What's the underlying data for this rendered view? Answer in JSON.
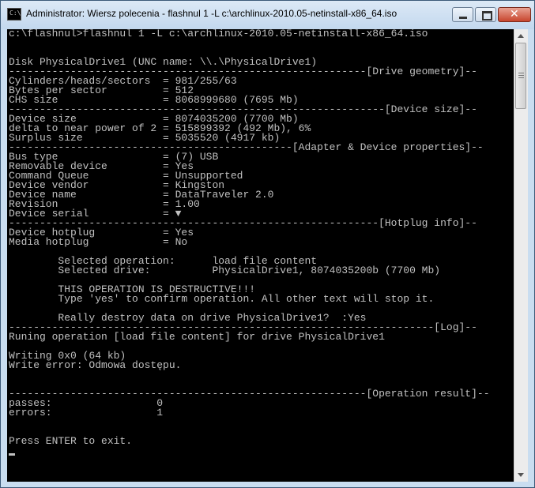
{
  "window": {
    "title": "Administrator: Wiersz polecenia - flashnul  1 -L c:\\archlinux-2010.05-netinstall-x86_64.iso",
    "icon_label": "C:\\",
    "icon": "console-icon"
  },
  "controls": {
    "minimize_icon": "minimize-icon",
    "maximize_icon": "maximize-icon",
    "close_icon": "close-icon",
    "close_glyph": "✕"
  },
  "console": {
    "lines": [
      "c:\\flashnul>flashnul 1 -L c:\\archlinux-2010.05-netinstall-x86_64.iso",
      "",
      "",
      "Disk PhysicalDrive1 (UNC name: \\\\.\\PhysicalDrive1)",
      "----------------------------------------------------------[Drive geometry]--",
      "Cylinders/heads/sectors  = 981/255/63",
      "Bytes per sector         = 512",
      "CHS size                 = 8068999680 (7695 Mb)",
      "-------------------------------------------------------------[Device size]--",
      "Device size              = 8074035200 (7700 Mb)",
      "delta to near power of 2 = 515899392 (492 Mb), 6%",
      "Surplus size             = 5035520 (4917 kb)",
      "----------------------------------------------[Adapter & Device properties]--",
      "Bus type                 = (7) USB",
      "Removable device         = Yes",
      "Command Queue            = Unsupported",
      "Device vendor            = Kingston",
      "Device name              = DataTraveler 2.0",
      "Revision                 = 1.00",
      "Device serial            = ▼",
      "------------------------------------------------------------[Hotplug info]--",
      "Device hotplug           = Yes",
      "Media hotplug            = No",
      "",
      "        Selected operation:      load file content",
      "        Selected drive:          PhysicalDrive1, 8074035200b (7700 Mb)",
      "",
      "        THIS OPERATION IS DESTRUCTIVE!!!",
      "        Type 'yes' to confirm operation. All other text will stop it.",
      "",
      "        Really destroy data on drive PhysicalDrive1?  :Yes",
      "---------------------------------------------------------------------[Log]--",
      "Runing operation [load file content] for drive PhysicalDrive1",
      "",
      "Writing 0x0 (64 kb)",
      "Write error: Odmowa dostępu.",
      "",
      "",
      "----------------------------------------------------------[Operation result]--",
      "passes:                 0",
      "errors:                 1",
      "",
      "",
      "Press ENTER to exit.",
      ""
    ]
  },
  "scrollbar": {
    "up_icon": "scroll-up-arrow-icon",
    "down_icon": "scroll-down-arrow-icon"
  }
}
